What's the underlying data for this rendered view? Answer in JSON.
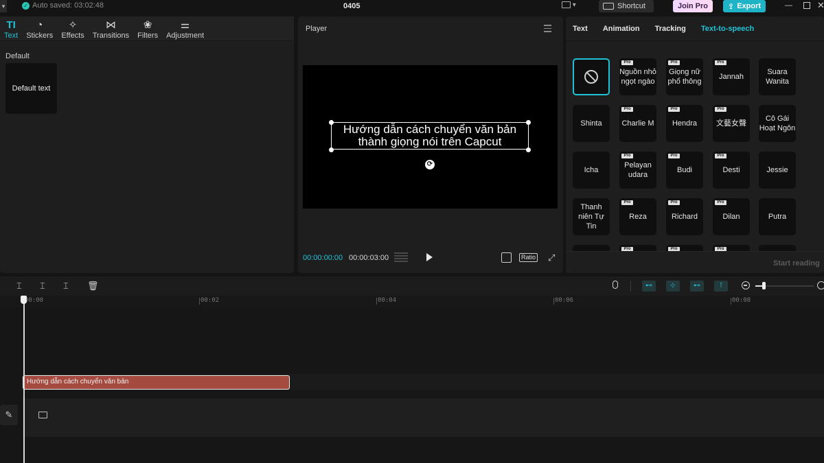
{
  "topbar": {
    "autosave": "Auto saved: 03:02:48",
    "project_title": "0405",
    "shortcut_label": "Shortcut",
    "join_pro_label": "Join Pro",
    "export_label": "Export"
  },
  "left": {
    "tabs": [
      {
        "label": "Text",
        "icon": "text-icon",
        "glyph": "TI"
      },
      {
        "label": "Stickers",
        "icon": "sticker-icon",
        "glyph": "◔"
      },
      {
        "label": "Effects",
        "icon": "effects-icon",
        "glyph": "✧"
      },
      {
        "label": "Transitions",
        "icon": "transition-icon",
        "glyph": "⋈"
      },
      {
        "label": "Filters",
        "icon": "filters-icon",
        "glyph": "❀"
      },
      {
        "label": "Adjustment",
        "icon": "adjustment-icon",
        "glyph": "⚌"
      }
    ],
    "section": "Default",
    "default_card": "Default text"
  },
  "player": {
    "title": "Player",
    "caption_line1": "Hướng dẫn cách chuyển văn bản",
    "caption_line2": "thành giọng nói trên Capcut",
    "current_time": "00:00:00:00",
    "total_time": "00:00:03:00",
    "ratio_label": "Ratio"
  },
  "right": {
    "tabs": [
      "Text",
      "Animation",
      "Tracking",
      "Text-to-speech"
    ],
    "active_tab": "Text-to-speech",
    "start_reading": "Start reading",
    "pro_badge": "Pro",
    "voices": [
      {
        "label": "",
        "pro": false,
        "selected": true
      },
      {
        "label": "Nguồn nhỏ ngọt ngào",
        "pro": true
      },
      {
        "label": "Giọng nữ phổ thông",
        "pro": true
      },
      {
        "label": "Jannah",
        "pro": true
      },
      {
        "label": "Suara Wanita",
        "pro": false
      },
      {
        "label": "Shinta",
        "pro": false
      },
      {
        "label": "Charlie M",
        "pro": true
      },
      {
        "label": "Hendra",
        "pro": true
      },
      {
        "label": "文藝女聲",
        "pro": true
      },
      {
        "label": "Cô Gái Hoạt Ngôn",
        "pro": false
      },
      {
        "label": "Icha",
        "pro": false
      },
      {
        "label": "Pelayan udara",
        "pro": true
      },
      {
        "label": "Budi",
        "pro": true
      },
      {
        "label": "Desti",
        "pro": true
      },
      {
        "label": "Jessie",
        "pro": false
      },
      {
        "label": "Thanh niên Tự Tin",
        "pro": false
      },
      {
        "label": "Reza",
        "pro": true
      },
      {
        "label": "Richard",
        "pro": true
      },
      {
        "label": "Dilan",
        "pro": true
      },
      {
        "label": "Putra",
        "pro": false
      },
      {
        "label": "",
        "pro": false
      },
      {
        "label": "",
        "pro": true
      },
      {
        "label": "",
        "pro": true
      },
      {
        "label": "",
        "pro": true
      },
      {
        "label": "",
        "pro": false
      }
    ]
  },
  "timeline": {
    "ticks": [
      "00:00",
      "00:02",
      "00:04",
      "00:06",
      "00:08"
    ],
    "text_clip": "Hướng dẫn cách chuyển văn bản"
  },
  "colors": {
    "accent": "#1fc2d6",
    "clip": "#a54a3e",
    "background": "#141414"
  }
}
